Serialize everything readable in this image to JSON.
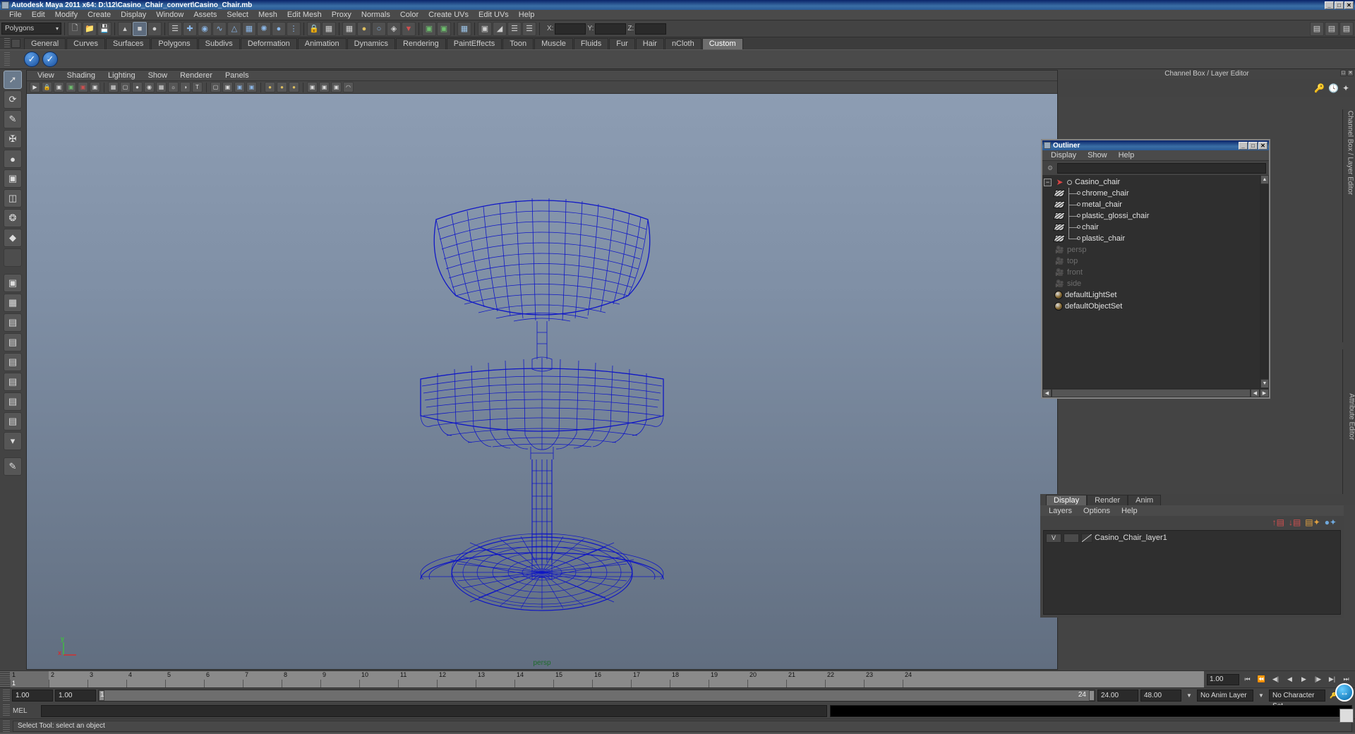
{
  "titlebar": {
    "title": "Autodesk Maya 2011 x64: D:\\12\\Casino_Chair_convert\\Casino_Chair.mb",
    "minimize": "_",
    "maximize": "□",
    "close": "✕"
  },
  "menubar": {
    "items": [
      "File",
      "Edit",
      "Modify",
      "Create",
      "Display",
      "Window",
      "Assets",
      "Select",
      "Mesh",
      "Edit Mesh",
      "Proxy",
      "Normals",
      "Color",
      "Create UVs",
      "Edit UVs",
      "Help"
    ]
  },
  "statusline": {
    "selection_mode": "Polygons",
    "x_label": "X:",
    "y_label": "Y:",
    "z_label": "Z:",
    "x_value": "",
    "y_value": "",
    "z_value": ""
  },
  "shelf": {
    "tabs": [
      "General",
      "Curves",
      "Surfaces",
      "Polygons",
      "Subdivs",
      "Deformation",
      "Animation",
      "Dynamics",
      "Rendering",
      "PaintEffects",
      "Toon",
      "Muscle",
      "Fluids",
      "Fur",
      "Hair",
      "nCloth",
      "Custom"
    ],
    "active_tab": "Custom",
    "items": [
      "check-icon",
      "check-icon"
    ]
  },
  "viewport": {
    "menu": [
      "View",
      "Shading",
      "Lighting",
      "Show",
      "Renderer",
      "Panels"
    ],
    "camera_label": "persp",
    "axis_x": "x",
    "axis_y": "y",
    "wireframe_color": "#0b12c8",
    "bg_top": "#8d9db3",
    "bg_bottom": "#616e80"
  },
  "channelbox": {
    "title": "Channel Box / Layer Editor",
    "vertical_tab_1": "Channel Box / Layer Editor",
    "vertical_tab_2": "Attribute Editor"
  },
  "outliner": {
    "title": "Outliner",
    "menu": [
      "Display",
      "Show",
      "Help"
    ],
    "search_value": "",
    "minimize": "_",
    "maximize": "□",
    "close": "✕",
    "root": {
      "label": "Casino_chair",
      "expander": "−"
    },
    "children": [
      "chrome_chair",
      "metal_chair",
      "plastic_glossi_chair",
      "chair",
      "plastic_chair"
    ],
    "cameras": [
      "persp",
      "top",
      "front",
      "side"
    ],
    "sets": [
      "defaultLightSet",
      "defaultObjectSet"
    ]
  },
  "layer_editor": {
    "tabs": [
      "Display",
      "Render",
      "Anim"
    ],
    "active_tab": "Display",
    "menu": [
      "Layers",
      "Options",
      "Help"
    ],
    "layers": [
      {
        "visibility": "V",
        "state": "",
        "name": "Casino_Chair_layer1"
      }
    ]
  },
  "timeline": {
    "ticks": [
      "1",
      "2",
      "3",
      "4",
      "5",
      "6",
      "7",
      "8",
      "9",
      "10",
      "11",
      "12",
      "13",
      "14",
      "15",
      "16",
      "17",
      "18",
      "19",
      "20",
      "21",
      "22",
      "23",
      "24"
    ],
    "current_frame": "1",
    "current_field": "1.00"
  },
  "range_slider": {
    "anim_start": "1.00",
    "anim_end": "1.00",
    "bar_start": "1",
    "bar_end": "24",
    "range_start": "24.00",
    "range_end": "48.00",
    "anim_layer": "No Anim Layer",
    "character_set": "No Character Set"
  },
  "command_line": {
    "label": "MEL",
    "input": "",
    "output": ""
  },
  "help_line": {
    "text": "Select Tool: select an object"
  }
}
